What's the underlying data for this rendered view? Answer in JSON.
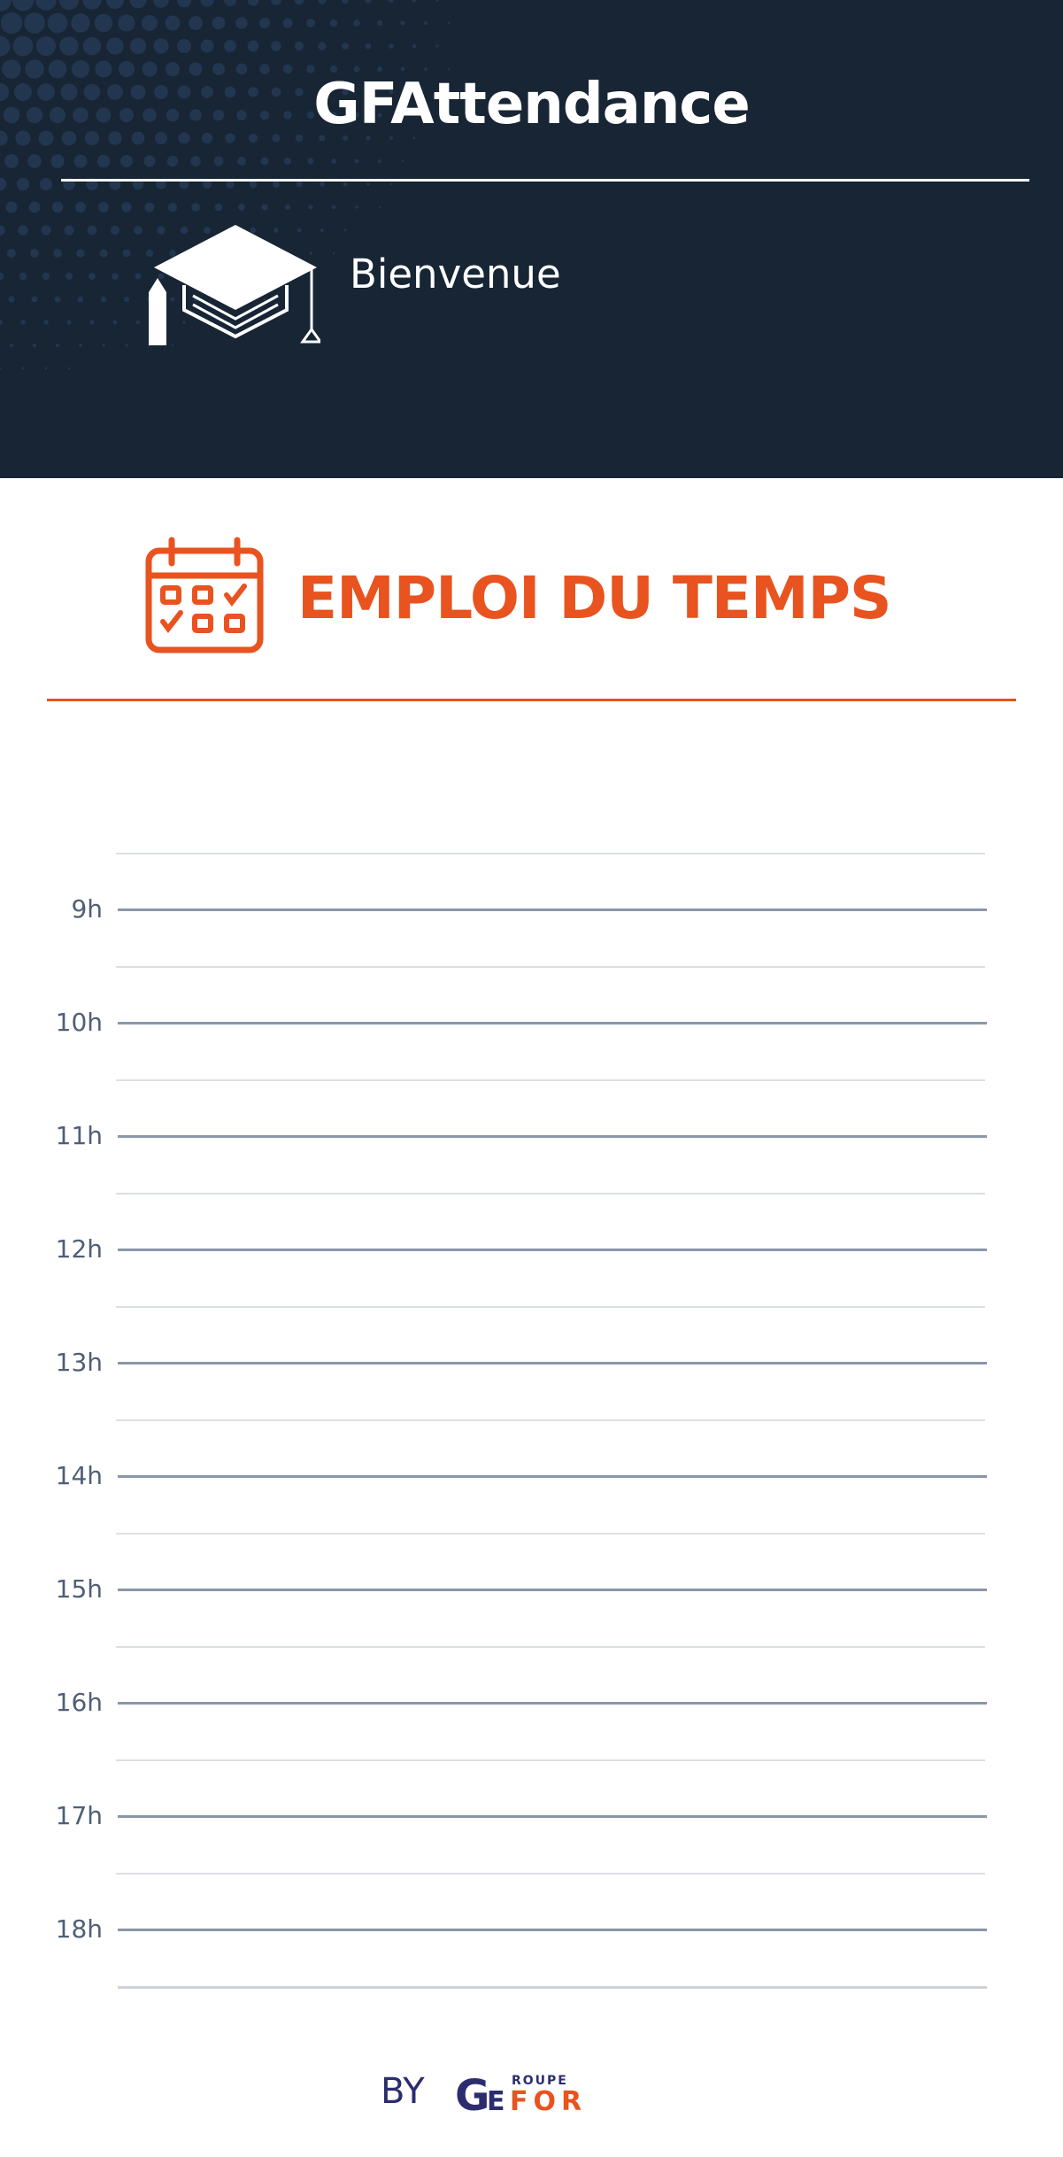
{
  "header": {
    "app_title": "GFAttendance",
    "welcome_text": "Bienvenue",
    "icon": "graduation-cap-icon",
    "background_color": "#172535"
  },
  "schedule": {
    "title": "EMPLOI DU TEMPS",
    "icon": "calendar-icon",
    "accent_color": "#e8531f",
    "hours": [
      "9h",
      "10h",
      "11h",
      "12h",
      "13h",
      "14h",
      "15h",
      "16h",
      "17h",
      "18h"
    ]
  },
  "footer": {
    "by_label": "BY",
    "brand": {
      "top_word": "ROUPE",
      "initial": "G",
      "main_left": "E",
      "main_right": "FOR",
      "primary_color": "#2b2d6e",
      "accent_color": "#e8531f"
    }
  }
}
